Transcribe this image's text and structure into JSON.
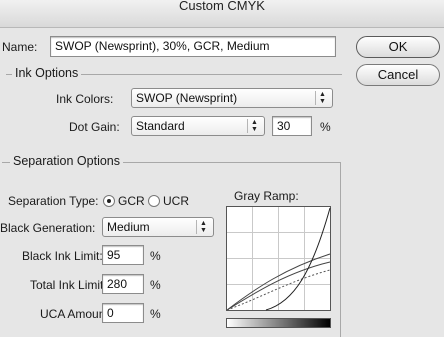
{
  "window": {
    "title": "Custom CMYK"
  },
  "name_field": {
    "label": "Name:",
    "value": "SWOP (Newsprint), 30%, GCR, Medium"
  },
  "buttons": {
    "ok": "OK",
    "cancel": "Cancel"
  },
  "ink_options": {
    "legend": "Ink Options",
    "ink_colors_label": "Ink Colors:",
    "ink_colors_value": "SWOP (Newsprint)",
    "dot_gain_label": "Dot Gain:",
    "dot_gain_value": "Standard",
    "dot_gain_amount": "30",
    "dot_gain_unit": "%"
  },
  "separation_options": {
    "legend": "Separation Options",
    "type_label": "Separation Type:",
    "type_gcr": "GCR",
    "type_ucr": "UCR",
    "selected_type": "GCR",
    "black_generation_label": "Black Generation:",
    "black_generation_value": "Medium",
    "black_ink_limit_label": "Black Ink Limit:",
    "black_ink_limit_value": "95",
    "total_ink_limit_label": "Total Ink Limit:",
    "total_ink_limit_value": "280",
    "uca_amount_label": "UCA Amount:",
    "uca_amount_value": "0",
    "percent_unit": "%",
    "gray_ramp_label": "Gray Ramp:"
  }
}
